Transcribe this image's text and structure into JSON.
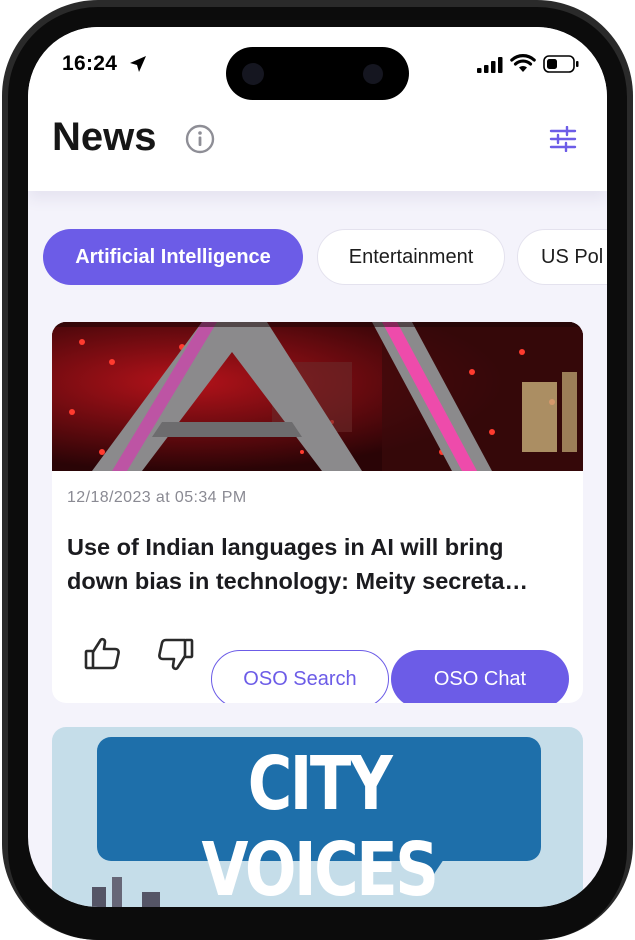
{
  "status_bar": {
    "time": "16:24"
  },
  "header": {
    "title": "News"
  },
  "categories": [
    {
      "label": "Artificial Intelligence",
      "selected": true
    },
    {
      "label": "Entertainment",
      "selected": false
    },
    {
      "label": "US Pol",
      "selected": false
    }
  ],
  "articles": [
    {
      "date": "12/18/2023 at 05:34 PM",
      "headline_line1": "Use of Indian languages in AI will bring",
      "headline_line2": "down bias in technology: Meity secreta…",
      "search_label": "OSO Search",
      "chat_label": "OSO Chat"
    },
    {
      "image_text": "CITY VOICES"
    }
  ],
  "colors": {
    "accent": "#6c5ce7",
    "background": "#f4f3fb"
  },
  "icons": [
    "location-arrow-icon",
    "signal-icon",
    "wifi-icon",
    "battery-icon",
    "info-icon",
    "filter-sliders-icon",
    "thumbs-up-icon",
    "thumbs-down-icon"
  ]
}
